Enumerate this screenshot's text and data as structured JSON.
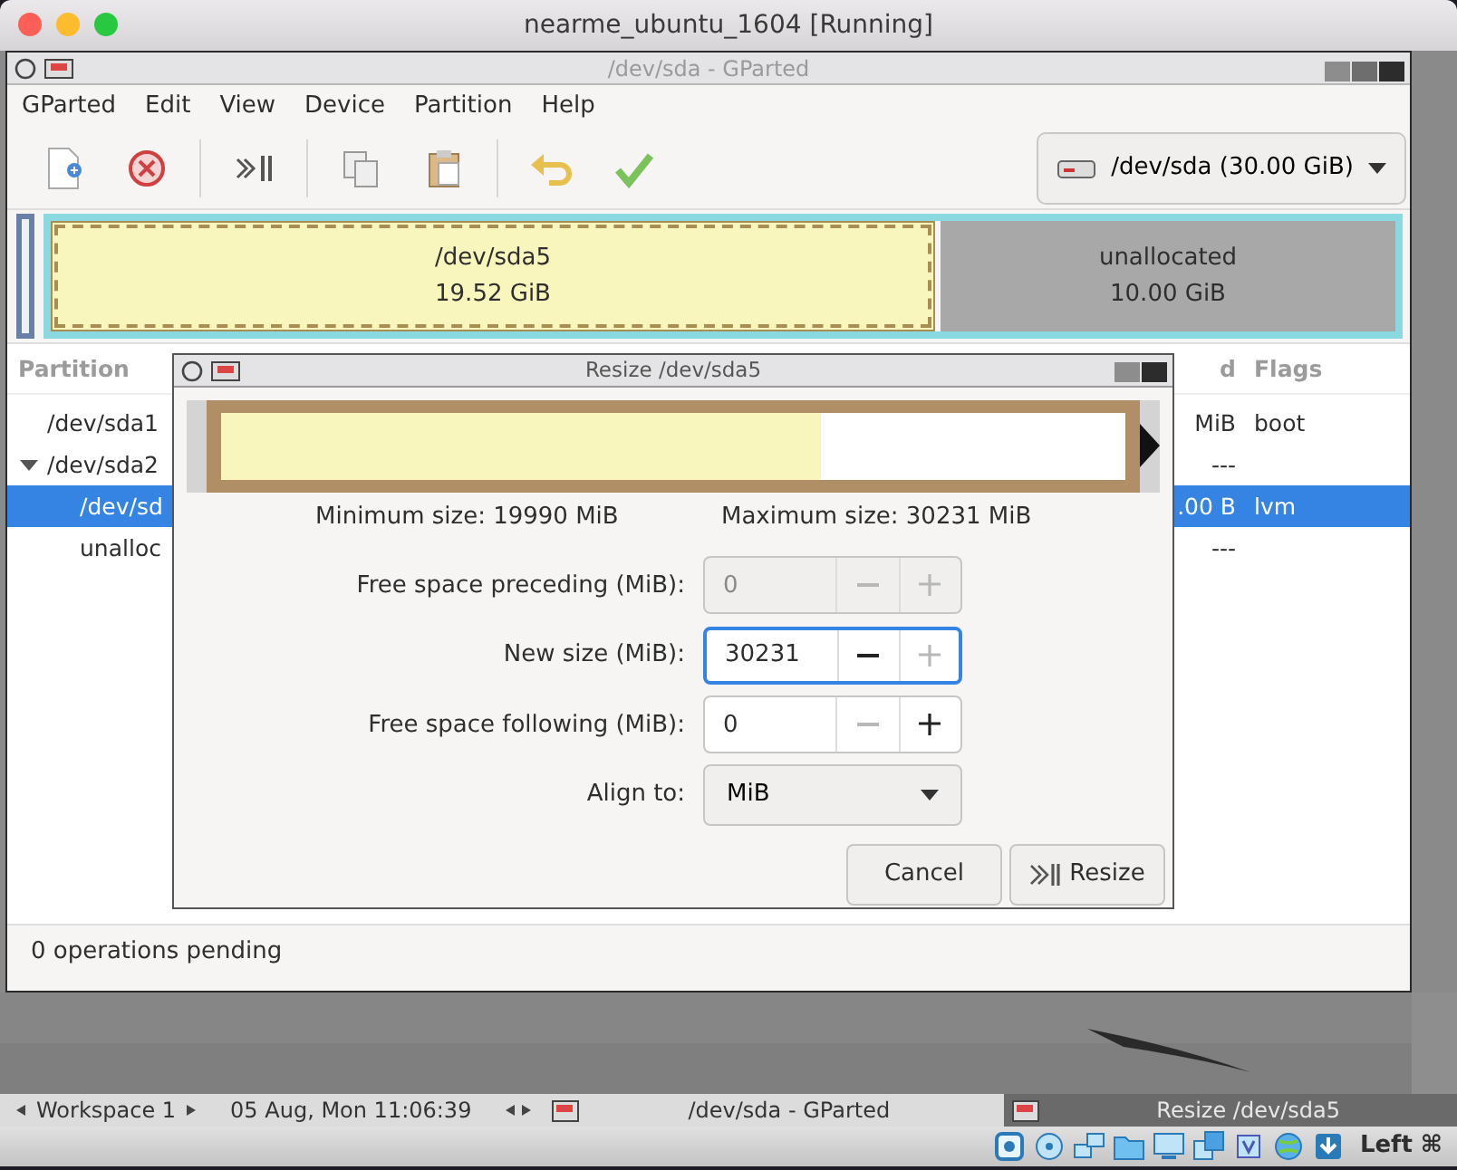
{
  "host_window": {
    "title": "nearme_ubuntu_1604 [Running]"
  },
  "app_window": {
    "title": "/dev/sda - GParted"
  },
  "menu": [
    "GParted",
    "Edit",
    "View",
    "Device",
    "Partition",
    "Help"
  ],
  "toolbar": [
    [
      {
        "kind": "new"
      },
      {
        "kind": "delete"
      }
    ],
    [
      {
        "kind": "resize"
      }
    ],
    [
      {
        "kind": "copy"
      },
      {
        "kind": "paste"
      }
    ],
    [
      {
        "kind": "undo"
      },
      {
        "kind": "apply"
      }
    ]
  ],
  "device_selector": "/dev/sda (30.00 GiB)",
  "disk_map": [
    {
      "name": "/dev/sda5",
      "size": "19.52 GiB",
      "kind": "partition",
      "selected": true
    },
    {
      "name": "unallocated",
      "size": "10.00 GiB",
      "kind": "unallocated",
      "selected": false
    }
  ],
  "table": {
    "columns": [
      "Partition",
      "d",
      "Flags"
    ],
    "rows": [
      {
        "partition": "/dev/sda1",
        "column_2": "MiB",
        "flags": "boot",
        "selected": false
      },
      {
        "partition": "/dev/sda2",
        "column_2": "---",
        "selected": false,
        "expanded": true,
        "children": [
          {
            "partition": "/dev/sd",
            "column_2": ".00 B",
            "flags": "lvm",
            "selected": true
          },
          {
            "partition": "unalloc",
            "column_2": "---",
            "selected": false
          }
        ]
      }
    ]
  },
  "status_bar": "0 operations pending",
  "dialog": {
    "title": "Resize /dev/sda5",
    "graph": {
      "level": 0.663
    },
    "min_size": "Minimum size: 19990 MiB",
    "max_size": "Maximum size: 30231 MiB",
    "fields": [
      {
        "kind": "spin",
        "label": "Free space preceding (MiB):",
        "value": "0",
        "disabled": true,
        "focused": false,
        "minus_disabled": true,
        "plus_disabled": true
      },
      {
        "kind": "spin",
        "label": "New size (MiB):",
        "value": "30231",
        "disabled": false,
        "focused": true,
        "minus_disabled": false,
        "plus_disabled": true
      },
      {
        "kind": "spin",
        "label": "Free space following (MiB):",
        "value": "0",
        "disabled": false,
        "focused": false,
        "minus_disabled": true,
        "plus_disabled": false
      },
      {
        "kind": "select",
        "label": "Align to:",
        "value": "MiB"
      }
    ],
    "buttons": [
      {
        "kind": "cancel",
        "label": "Cancel"
      },
      {
        "kind": "resize",
        "label": "Resize"
      }
    ]
  },
  "taskbar": {
    "workspace": "Workspace 1",
    "clock": "05 Aug, Mon 11:06:39",
    "tasks": [
      {
        "title": "/dev/sda - GParted",
        "selected": false
      },
      {
        "title": "Resize /dev/sda5",
        "selected": true
      }
    ]
  },
  "host_status": {
    "key": "Left ⌘"
  }
}
